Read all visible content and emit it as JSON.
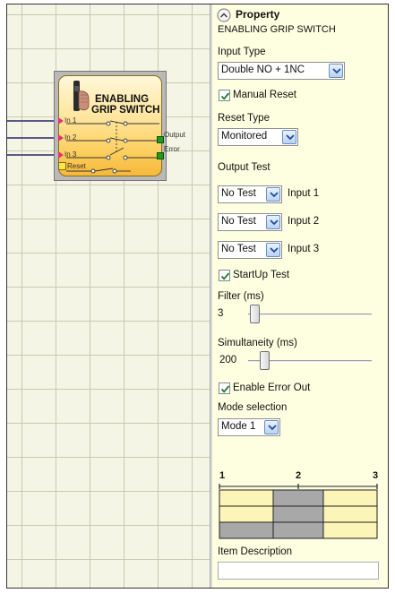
{
  "block": {
    "title_line1": "ENABLING",
    "title_line2": "GRIP SWITCH",
    "inputs": [
      "In 1",
      "In 2",
      "In 3",
      "Reset"
    ],
    "outputs": [
      "Output",
      "Error"
    ],
    "colors": {
      "output_square": "#1e9a1e",
      "input_arrow": "#e8306a"
    }
  },
  "panel": {
    "header": "Property",
    "component_name": "ENABLING GRIP SWITCH",
    "input_type_label": "Input Type",
    "input_type_value": "Double NO + 1NC",
    "manual_reset_label": "Manual Reset",
    "manual_reset_checked": true,
    "reset_type_label": "Reset Type",
    "reset_type_value": "Monitored",
    "output_test_label": "Output Test",
    "output_tests": [
      {
        "value": "No Test",
        "label": "Input 1"
      },
      {
        "value": "No Test",
        "label": "Input 2"
      },
      {
        "value": "No Test",
        "label": "Input 3"
      }
    ],
    "startup_test_label": "StartUp Test",
    "startup_test_checked": true,
    "filter_label": "Filter (ms)",
    "filter_value": "3",
    "simultaneity_label": "Simultaneity (ms)",
    "simultaneity_value": "200",
    "enable_error_out_label": "Enable Error Out",
    "enable_error_out_checked": true,
    "mode_selection_label": "Mode selection",
    "mode_selection_value": "Mode 1",
    "mode_diagram_positions": [
      "1",
      "2",
      "3"
    ],
    "item_description_label": "Item Description",
    "item_description_value": ""
  }
}
